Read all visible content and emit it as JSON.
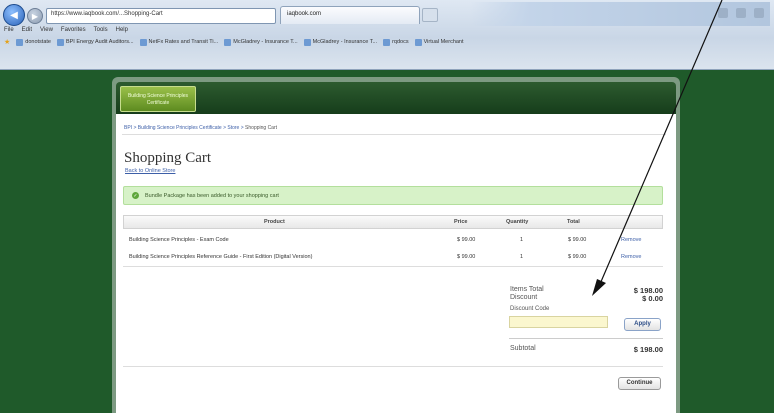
{
  "browser": {
    "address": "https://www.iaqbook.com/...Shopping-Cart",
    "tab_title": "iaqbook.com",
    "menu": [
      "File",
      "Edit",
      "View",
      "Favorites",
      "Tools",
      "Help"
    ],
    "favorites": [
      "donotstate",
      "BPI Energy Audit Auditors...",
      "NetFx Rates and Transit Ti...",
      "McGladrey - Insurance T...",
      "McGladrey - Insurance T...",
      "rqdocs",
      "Virtual Merchant"
    ]
  },
  "site": {
    "logo_text": "Building Science Principles Certificate"
  },
  "breadcrumb": {
    "link": "BPI > Building Science Principles Certificate > Store >",
    "current": "Shopping Cart"
  },
  "page": {
    "title": "Shopping Cart",
    "back_link": "Back to Online Store",
    "notice": "Bundle Package has been added to your shopping cart"
  },
  "cart": {
    "headers": {
      "product": "Product",
      "price": "Price",
      "quantity": "Quantity",
      "total": "Total"
    },
    "items": [
      {
        "product": "Building Science Principles - Exam Code",
        "price": "$ 99.00",
        "quantity": "1",
        "total": "$ 99.00",
        "remove": "Remove"
      },
      {
        "product": "Building Science Principles Reference Guide - First Edition (Digital Version)",
        "price": "$ 99.00",
        "quantity": "1",
        "total": "$ 99.00",
        "remove": "Remove"
      }
    ]
  },
  "totals": {
    "items_total_label": "Items Total",
    "items_total": "$ 198.00",
    "discount_label": "Discount",
    "discount": "$ 0.00",
    "discount_code_label": "Discount Code",
    "discount_code_value": "",
    "apply_label": "Apply",
    "subtotal_label": "Subtotal",
    "subtotal": "$ 198.00",
    "continue_label": "Continue"
  },
  "colors": {
    "page_background": "#1f5a2a",
    "notice_background": "#d7f2c8",
    "link": "#3d5fa8"
  }
}
